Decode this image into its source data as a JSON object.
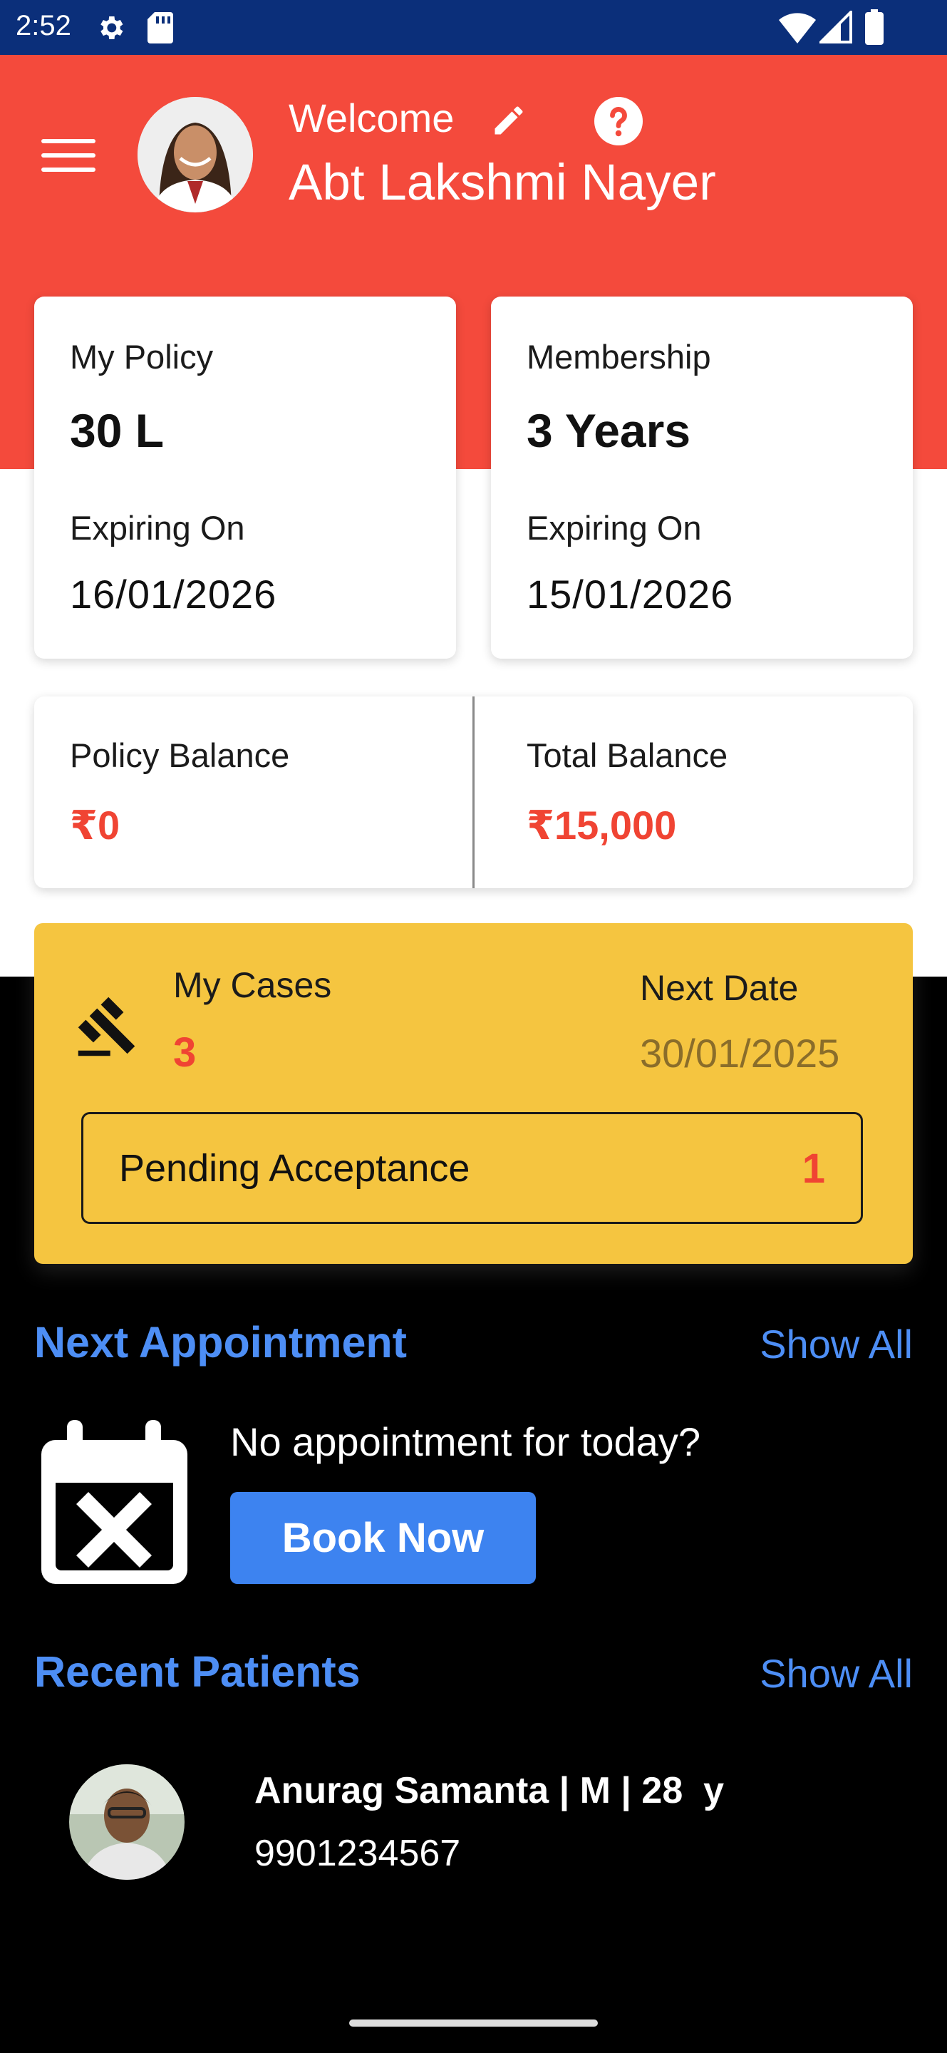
{
  "status_bar": {
    "time": "2:52"
  },
  "header": {
    "welcome_label": "Welcome",
    "user_name": "Abt Lakshmi Nayer"
  },
  "policy_card": {
    "title": "My Policy",
    "value": "30 L",
    "expiry_label": "Expiring On",
    "expiry_date": "16/01/2026"
  },
  "membership_card": {
    "title": "Membership",
    "value": "3 Years",
    "expiry_label": "Expiring On",
    "expiry_date": "15/01/2026"
  },
  "balances": {
    "policy_label": "Policy Balance",
    "policy_value": "₹0",
    "total_label": "Total Balance",
    "total_value": "₹15,000"
  },
  "cases": {
    "title": "My Cases",
    "count": "3",
    "next_date_label": "Next Date",
    "next_date": "30/01/2025",
    "pending_label": "Pending Acceptance",
    "pending_count": "1"
  },
  "appointments": {
    "title": "Next Appointment",
    "show_all": "Show All",
    "empty_text": "No appointment for today?",
    "book_label": "Book Now"
  },
  "recent_patients": {
    "title": "Recent Patients",
    "show_all": "Show All",
    "patients": [
      {
        "summary": "Anurag Samanta | M | 28  y",
        "phone": "9901234567"
      }
    ]
  },
  "colors": {
    "header": "#f44a3c",
    "status_bar": "#0b2f7a",
    "accent_blue": "#4d8ef5",
    "cases_yellow": "#f5c540",
    "value_red": "#f04433"
  },
  "icons": [
    "settings-icon",
    "sd-card-icon",
    "wifi-icon",
    "signal-icon",
    "battery-icon",
    "menu-icon",
    "edit-icon",
    "help-icon",
    "gavel-icon",
    "calendar-x-icon"
  ]
}
